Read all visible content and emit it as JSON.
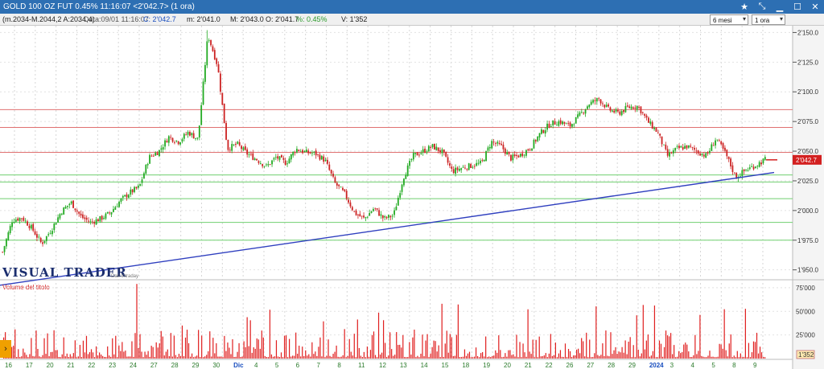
{
  "window": {
    "title": "GOLD 100 OZ FUT 0.45% 11:16:07  <2'042.7> (1 ora)",
    "icons": [
      "star-icon",
      "resize-icon",
      "minimize-icon",
      "maximize-icon",
      "close-icon"
    ]
  },
  "info": {
    "indicator": "(m.2034-M.2044,2 A:2034,4)",
    "date": "Data:09/01 11:16:07",
    "close": "C: 2'042.7",
    "min": "m: 2'041.0",
    "max": "M: 2'043.0",
    "open": "O: 2'041.7",
    "pct": "%: 0.45%",
    "vol": "V: 1'352"
  },
  "controls": {
    "period": "6 mesi",
    "interval": "1 ora"
  },
  "brand": {
    "logo": "VISUAL TRADER",
    "sub": "Dati Intraday"
  },
  "colors": {
    "up": "#22aa22",
    "down": "#cc2222",
    "trend": "#2f3fbf",
    "resistance": "#e07070",
    "support": "#6fcf6f",
    "price_badge": "#d32020",
    "volume": "#e02020"
  },
  "chart_data": {
    "type": "candlestick",
    "price_axis": {
      "ticks": [
        1950,
        1975,
        2000,
        2025,
        2050,
        2075,
        2100,
        2125,
        2150
      ],
      "tick_labels": [
        "1'950.0",
        "1'975.0",
        "2'000.0",
        "2'025.0",
        "2'050.0",
        "2'075.0",
        "2'100.0",
        "2'125.0",
        "2'150.0"
      ],
      "range": [
        1943,
        2153
      ]
    },
    "last_price": 2042.7,
    "last_price_label": "2'042.7",
    "resistance_levels": [
      2085,
      2070,
      2049
    ],
    "support_levels": [
      2030,
      2024,
      2010,
      1990,
      1975
    ],
    "trendline": {
      "from": [
        "16 Nov",
        1935
      ],
      "to": [
        "9 Jan",
        2032
      ]
    },
    "x_axis": {
      "labels": [
        "16",
        "17",
        "20",
        "21",
        "22",
        "23",
        "24",
        "27",
        "28",
        "29",
        "30",
        "Dic",
        "4",
        "5",
        "6",
        "7",
        "8",
        "11",
        "12",
        "13",
        "14",
        "15",
        "18",
        "19",
        "20",
        "21",
        "22",
        "26",
        "27",
        "28",
        "29",
        "2024",
        "3",
        "4",
        "5",
        "8",
        "9"
      ],
      "month_labels": [
        "Dic",
        "2024"
      ]
    },
    "close_path": [
      1965,
      1992,
      1994,
      1985,
      1972,
      1984,
      1999,
      2007,
      1995,
      1990,
      1993,
      1998,
      2008,
      2015,
      2020,
      2045,
      2050,
      2062,
      2058,
      2066,
      2060,
      2148,
      2122,
      2052,
      2056,
      2048,
      2043,
      2037,
      2045,
      2040,
      2052,
      2049,
      2048,
      2042,
      2023,
      2014,
      1998,
      1993,
      2002,
      1993,
      1996,
      2028,
      2046,
      2050,
      2054,
      2049,
      2033,
      2036,
      2038,
      2040,
      2058,
      2054,
      2044,
      2047,
      2053,
      2065,
      2073,
      2075,
      2071,
      2080,
      2090,
      2094,
      2085,
      2082,
      2087,
      2088,
      2075,
      2066,
      2046,
      2052,
      2054,
      2050,
      2046,
      2061,
      2047,
      2028,
      2034,
      2038,
      2043
    ],
    "volume_panel": {
      "title": "Volume del titolo",
      "ticks": [
        25000,
        50000,
        75000
      ],
      "tick_labels": [
        "25'000",
        "50'000",
        "75'000"
      ],
      "last_label": "1'352"
    }
  }
}
